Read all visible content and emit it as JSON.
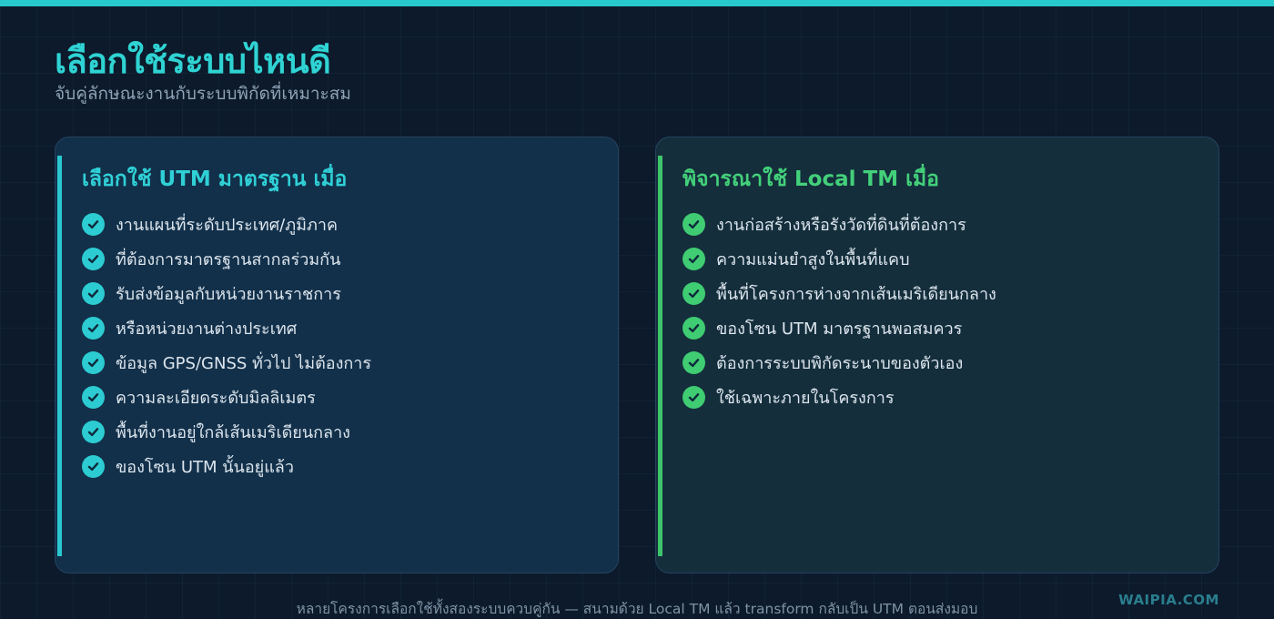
{
  "header": {
    "title": "เลือกใช้ระบบไหนดี",
    "subtitle": "จับคู่ลักษณะงานกับระบบพิกัดที่เหมาะสม"
  },
  "cards": [
    {
      "title": "เลือกใช้ UTM มาตรฐาน เมื่อ",
      "items": [
        "งานแผนที่ระดับประเทศ/ภูมิภาค",
        "ที่ต้องการมาตรฐานสากลร่วมกัน",
        "รับส่งข้อมูลกับหน่วยงานราชการ",
        "หรือหน่วยงานต่างประเทศ",
        "ข้อมูล GPS/GNSS ทั่วไป ไม่ต้องการ",
        "ความละเอียดระดับมิลลิเมตร",
        "พื้นที่งานอยู่ใกล้เส้นเมริเดียนกลาง",
        "ของโซน UTM นั้นอยู่แล้ว"
      ]
    },
    {
      "title": "พิจารณาใช้ Local TM เมื่อ",
      "items": [
        "งานก่อสร้างหรือรังวัดที่ดินที่ต้องการ",
        "ความแม่นยำสูงในพื้นที่แคบ",
        "พื้นที่โครงการห่างจากเส้นเมริเดียนกลาง",
        "ของโซน UTM มาตรฐานพอสมควร",
        "ต้องการระบบพิกัดระนาบของตัวเอง",
        "ใช้เฉพาะภายในโครงการ"
      ]
    }
  ],
  "footer": {
    "note": "หลายโครงการเลือกใช้ทั้งสองระบบควบคู่กัน — สนามด้วย Local TM แล้ว transform กลับเป็น UTM ตอนส่งมอบ",
    "brand": "WAIPIA.COM"
  },
  "colors": {
    "accent_cyan": "#2fd3d3",
    "accent_green": "#43d07a",
    "background": "#0c1a2b"
  },
  "icons": {
    "list_marker": "check-circle-icon"
  }
}
